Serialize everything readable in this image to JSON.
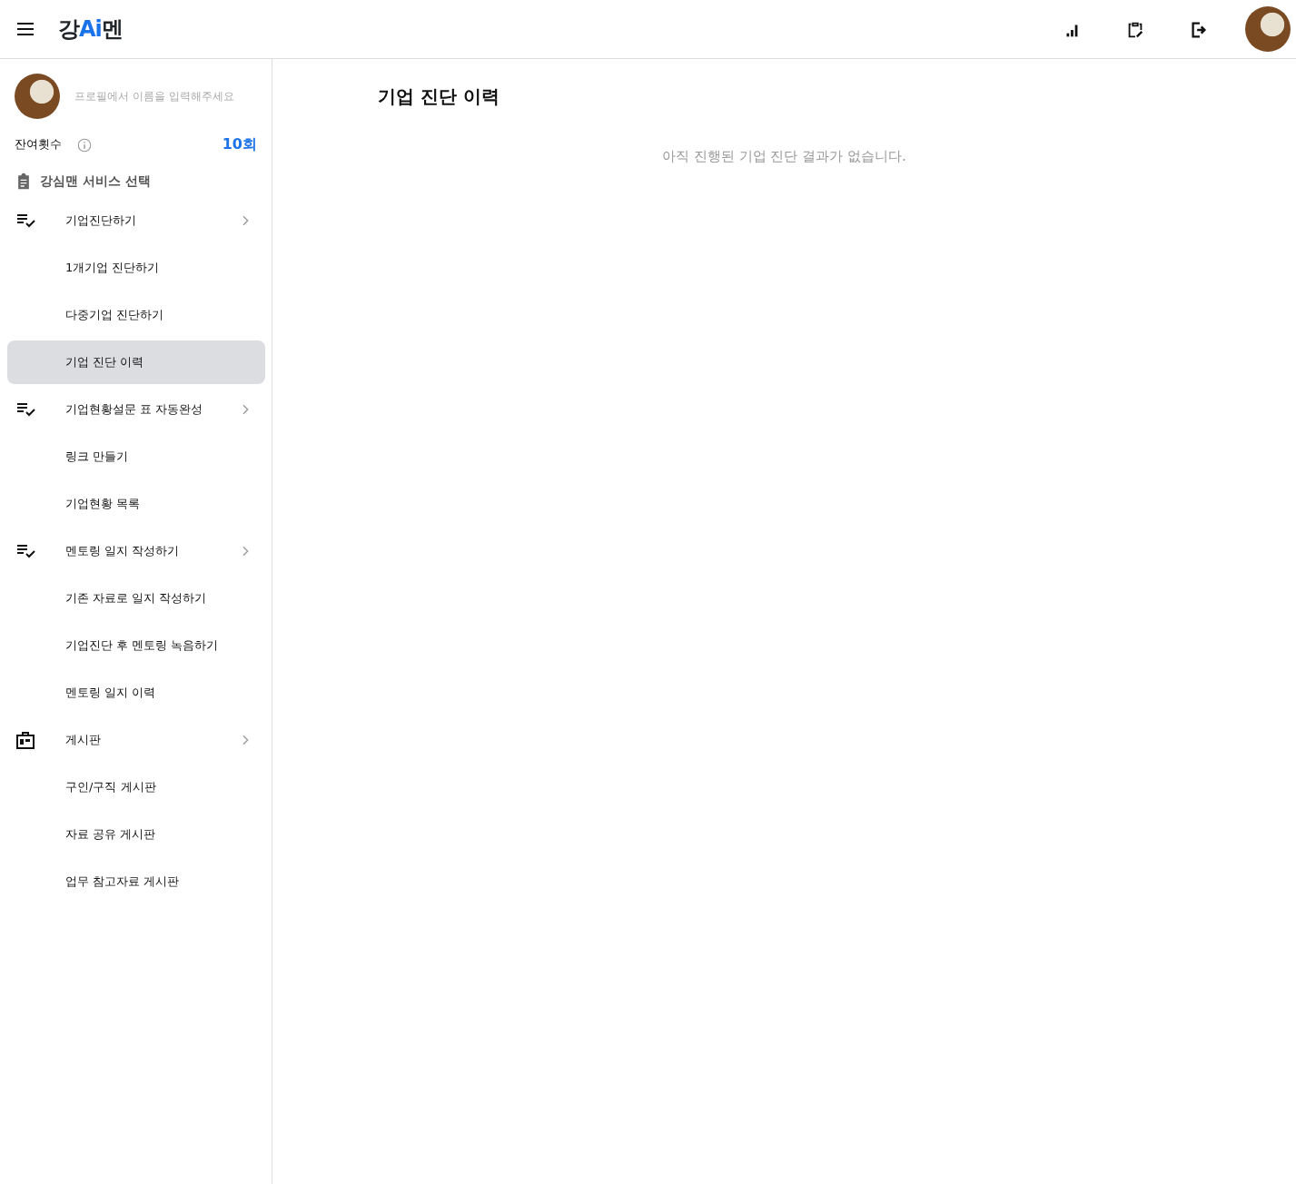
{
  "header": {
    "logo": [
      {
        "text": "강",
        "highlight": false
      },
      {
        "text": "Ai",
        "highlight": true
      },
      {
        "text": "멘",
        "highlight": false
      }
    ]
  },
  "sidebar": {
    "profile_hint": "프로필에서 이름을 입력해주세요",
    "remaining_label": "잔여횟수",
    "remaining_count": "10회",
    "section_title": "강심맨 서비스 선택",
    "groups": [
      {
        "label": "기업진단하기",
        "kind": "checklist",
        "children": [
          {
            "label": "1개기업 진단하기",
            "selected": false
          },
          {
            "label": "다중기업 진단하기",
            "selected": false
          },
          {
            "label": "기업 진단 이력",
            "selected": true
          }
        ]
      },
      {
        "label": "기업현황설문 표 자동완성",
        "kind": "checklist",
        "children": [
          {
            "label": "링크 만들기",
            "selected": false
          },
          {
            "label": "기업현황 목록",
            "selected": false
          }
        ]
      },
      {
        "label": "멘토링 일지 작성하기",
        "kind": "checklist",
        "children": [
          {
            "label": "기존 자료로 일지 작성하기",
            "selected": false
          },
          {
            "label": "기업진단 후 멘토링 녹음하기",
            "selected": false
          },
          {
            "label": "멘토링 일지 이력",
            "selected": false
          }
        ]
      },
      {
        "label": "게시판",
        "kind": "building",
        "children": [
          {
            "label": "구인/구직 게시판",
            "selected": false
          },
          {
            "label": "자료 공유 게시판",
            "selected": false
          },
          {
            "label": "업무 참고자료 게시판",
            "selected": false
          }
        ]
      }
    ]
  },
  "main": {
    "title": "기업 진단 이력",
    "empty_message": "아직 진행된 기업 진단 결과가 없습니다."
  }
}
